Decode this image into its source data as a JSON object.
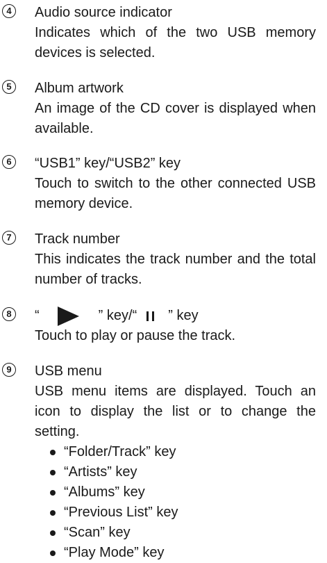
{
  "items": [
    {
      "number": "4",
      "title": "Audio source indicator",
      "description": "Indicates which of the two USB memory devices is selected."
    },
    {
      "number": "5",
      "title": "Album artwork",
      "description": "An image of the CD cover is displayed when available."
    },
    {
      "number": "6",
      "title": "“USB1” key/“USB2” key",
      "description": "Touch to switch to the other connected USB memory device."
    },
    {
      "number": "7",
      "title": "Track number",
      "description": "This indicates the track number and the total number of tracks."
    },
    {
      "number": "8",
      "title_open_quote": "“",
      "title_play_close": "” key/“",
      "title_pause_close": "” key",
      "description": "Touch to play or pause the track."
    },
    {
      "number": "9",
      "title": "USB menu",
      "description": "USB menu items are displayed. Touch an icon to display the list or to change the setting."
    }
  ],
  "usb_menu_keys": [
    "“Folder/Track” key",
    "“Artists” key",
    "“Albums” key",
    "“Previous List” key",
    "“Scan” key",
    "“Play Mode” key"
  ]
}
